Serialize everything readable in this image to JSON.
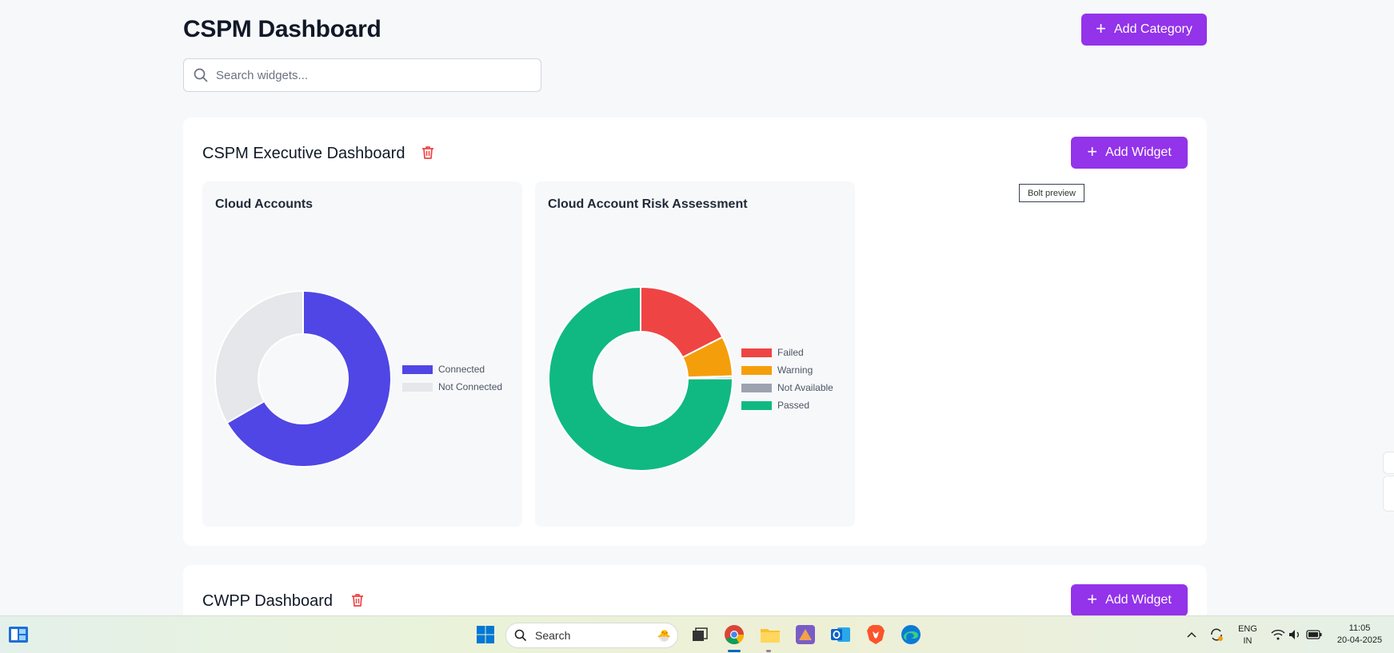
{
  "header": {
    "title": "CSPM Dashboard",
    "add_category_label": "Add Category",
    "search_placeholder": "Search widgets..."
  },
  "categories": [
    {
      "title": "CSPM Executive Dashboard",
      "add_widget_label": "Add Widget",
      "widgets": [
        {
          "title": "Cloud Accounts",
          "chart_data": {
            "type": "pie",
            "donut": true,
            "labels": [
              "Connected",
              "Not Connected"
            ],
            "values": [
              2,
              1
            ],
            "colors": [
              "#4f46e5",
              "#e5e7eb"
            ],
            "legend": "right"
          }
        },
        {
          "title": "Cloud Account Risk Assessment",
          "chart_data": {
            "type": "pie",
            "donut": true,
            "labels": [
              "Failed",
              "Warning",
              "Not Available",
              "Passed"
            ],
            "values": [
              1689,
              681,
              36,
              7253
            ],
            "colors": [
              "#ef4444",
              "#f59e0b",
              "#9ca3af",
              "#10b981"
            ],
            "legend": "right"
          }
        }
      ]
    },
    {
      "title": "CWPP Dashboard",
      "add_widget_label": "Add Widget"
    }
  ],
  "tooltip": "Bolt preview",
  "taskbar": {
    "search_label": "Search",
    "language": "ENG",
    "region": "IN",
    "time": "11:05",
    "date": "20-04-2025",
    "icons": [
      "widgets-icon",
      "windows-start-icon",
      "task-view-icon",
      "chrome-icon",
      "file-explorer-icon",
      "game-icon",
      "outlook-icon",
      "brave-icon",
      "edge-icon"
    ]
  }
}
